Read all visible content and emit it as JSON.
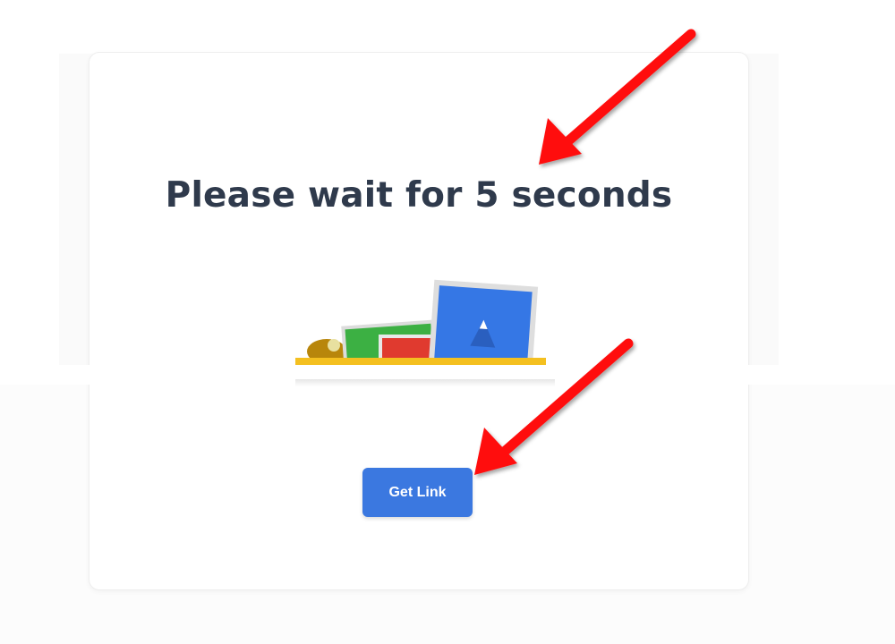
{
  "page": {
    "heading": "Please wait for 5 seconds"
  },
  "actions": {
    "get_link_label": "Get Link"
  },
  "illustration": {
    "icon": "folder-with-photos-icon"
  },
  "annotations": {
    "arrow_color": "#ff0000",
    "arrow_count": 2
  },
  "colors": {
    "button": "#3b78e0",
    "heading": "#2f3a4c"
  }
}
